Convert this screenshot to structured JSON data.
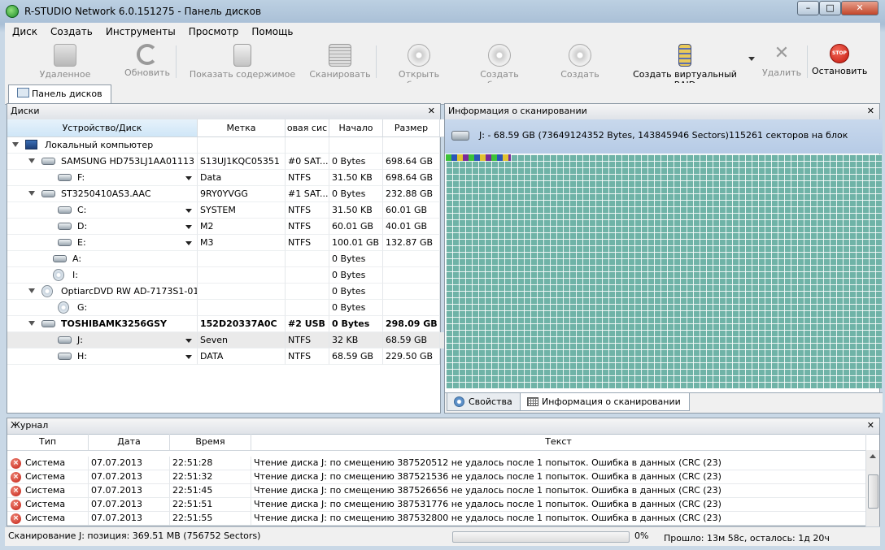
{
  "window": {
    "title": "R-STUDIO Network 6.0.151275 - Панель дисков"
  },
  "menu": [
    "Диск",
    "Создать",
    "Инструменты",
    "Просмотр",
    "Помощь"
  ],
  "toolbar": {
    "remote": "Удаленное подключение",
    "refresh": "Обновить",
    "show_contents": "Показать содержимое диска",
    "scan": "Сканировать",
    "open_image": "Открыть образ...",
    "create_image": "Создать образ...",
    "create_region": "Создать регион...",
    "create_raid": "Создать виртуальный RAID",
    "delete": "Удалить",
    "stop": "Остановить"
  },
  "tabs": {
    "disk_panel": "Панель дисков"
  },
  "disks_panel": {
    "title": "Диски",
    "columns": [
      "Устройство/Диск",
      "Метка",
      "овая сис",
      "Начало",
      "Размер"
    ],
    "rows": [
      {
        "name": "Локальный компьютер",
        "label": "",
        "fs": "",
        "start": "",
        "size": ""
      },
      {
        "name": "SAMSUNG HD753LJ1AA01113",
        "label": "S13UJ1KQC05351",
        "fs": "#0 SAT...",
        "start": "0 Bytes",
        "size": "698.64 GB"
      },
      {
        "name": "F:",
        "label": "Data",
        "fs": "NTFS",
        "start": "31.50 KB",
        "size": "698.64 GB"
      },
      {
        "name": "ST3250410AS3.AAC",
        "label": "9RY0YVGG",
        "fs": "#1 SAT...",
        "start": "0 Bytes",
        "size": "232.88 GB"
      },
      {
        "name": "C:",
        "label": "SYSTEM",
        "fs": "NTFS",
        "start": "31.50 KB",
        "size": "60.01 GB"
      },
      {
        "name": "D:",
        "label": "M2",
        "fs": "NTFS",
        "start": "60.01 GB",
        "size": "40.01 GB"
      },
      {
        "name": "E:",
        "label": "M3",
        "fs": "NTFS",
        "start": "100.01 GB",
        "size": "132.87 GB"
      },
      {
        "name": "A:",
        "label": "",
        "fs": "",
        "start": "0 Bytes",
        "size": ""
      },
      {
        "name": "I:",
        "label": "",
        "fs": "",
        "start": "0 Bytes",
        "size": ""
      },
      {
        "name": "OptiarcDVD RW AD-7173S1-01",
        "label": "",
        "fs": "",
        "start": "0 Bytes",
        "size": ""
      },
      {
        "name": "G:",
        "label": "",
        "fs": "",
        "start": "0 Bytes",
        "size": ""
      },
      {
        "name": "TOSHIBAMK3256GSY",
        "label": "152D20337A0C",
        "fs": "#2 USB",
        "start": "0 Bytes",
        "size": "298.09 GB"
      },
      {
        "name": "J:",
        "label": "Seven",
        "fs": "NTFS",
        "start": "32 KB",
        "size": "68.59 GB"
      },
      {
        "name": "H:",
        "label": "DATA",
        "fs": "NTFS",
        "start": "68.59 GB",
        "size": "229.50 GB"
      }
    ]
  },
  "scan_panel": {
    "title": "Информация о сканировании",
    "disk_info": "J: - 68.59 GB (73649124352 Bytes, 143845946 Sectors)115261 секторов на блок",
    "tab_properties": "Свойства",
    "tab_scan_info": "Информация о сканировании"
  },
  "log": {
    "title": "Журнал",
    "columns": [
      "Тип",
      "Дата",
      "Время",
      "Текст"
    ],
    "rows": [
      {
        "type": "Система",
        "date": "07.07.2013",
        "time": "22:51:28",
        "text": "Чтение диска J: по смещению 387520512 не удалось после 1 попыток. Ошибка в данных (CRC (23)"
      },
      {
        "type": "Система",
        "date": "07.07.2013",
        "time": "22:51:32",
        "text": "Чтение диска J: по смещению 387521536 не удалось после 1 попыток. Ошибка в данных (CRC (23)"
      },
      {
        "type": "Система",
        "date": "07.07.2013",
        "time": "22:51:45",
        "text": "Чтение диска J: по смещению 387526656 не удалось после 1 попыток. Ошибка в данных (CRC (23)"
      },
      {
        "type": "Система",
        "date": "07.07.2013",
        "time": "22:51:51",
        "text": "Чтение диска J: по смещению 387531776 не удалось после 1 попыток. Ошибка в данных (CRC (23)"
      },
      {
        "type": "Система",
        "date": "07.07.2013",
        "time": "22:51:55",
        "text": "Чтение диска J: по смещению 387532800 не удалось после 1 попыток. Ошибка в данных (CRC (23)"
      }
    ]
  },
  "status": {
    "scan_position": "Сканирование J: позиция: 369.51 MB (756752 Sectors)",
    "percent": "0%",
    "progress_value": 0,
    "elapsed": "Прошло: 13м 58с, осталось: 1д 20ч"
  },
  "colors": {
    "scan_block": "#6fb3a7",
    "selection_header": "#b6cbe6"
  }
}
